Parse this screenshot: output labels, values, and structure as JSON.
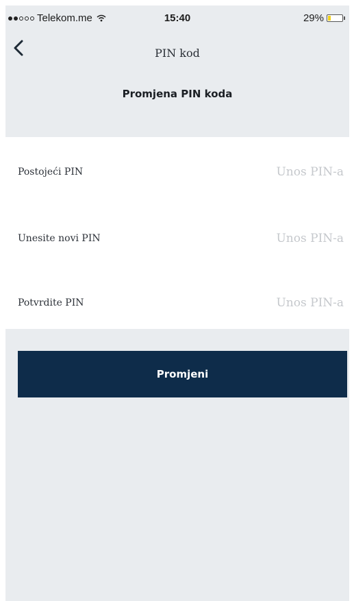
{
  "status_bar": {
    "carrier": "Telekom.me",
    "time": "15:40",
    "battery": "29%",
    "battery_level": 0.29,
    "signal_icon": "signal-dots-icon",
    "wifi_icon": "wifi-icon",
    "battery_icon": "battery-icon"
  },
  "nav": {
    "title": "PIN kod",
    "back_icon": "chevron-left-icon"
  },
  "section": {
    "title": "Promjena PIN koda"
  },
  "form": {
    "fields": [
      {
        "label": "Postojeći PIN",
        "placeholder": "Unos PIN-a",
        "value": ""
      },
      {
        "label": "Unesite novi PIN",
        "placeholder": "Unos PIN-a",
        "value": ""
      },
      {
        "label": "Potvrdite PIN",
        "placeholder": "Unos PIN-a",
        "value": ""
      }
    ]
  },
  "actions": {
    "submit_label": "Promjeni"
  },
  "colors": {
    "background": "#e9ecef",
    "card": "#ffffff",
    "button": "#0e2c4a",
    "button_text": "#ffffff",
    "placeholder": "#c5c8cc",
    "battery_fill": "#f2d21b"
  }
}
